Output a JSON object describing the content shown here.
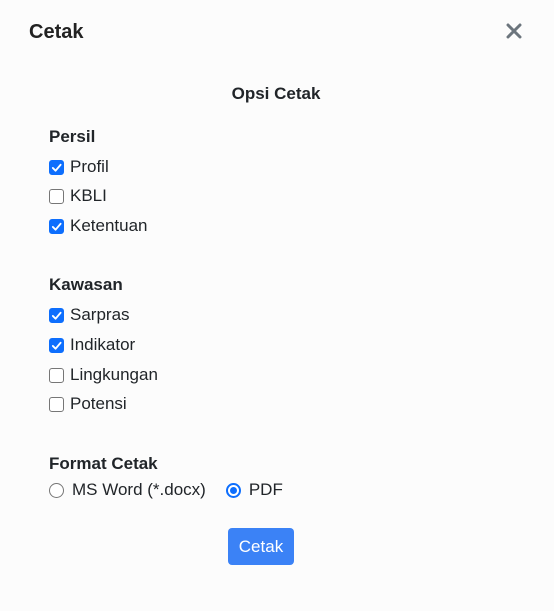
{
  "dialog": {
    "title": "Cetak",
    "close_icon": "close-icon",
    "heading": "Opsi Cetak"
  },
  "persil": {
    "title": "Persil",
    "options": [
      {
        "label": "Profil",
        "checked": true
      },
      {
        "label": "KBLI",
        "checked": false
      },
      {
        "label": "Ketentuan",
        "checked": true
      }
    ]
  },
  "kawasan": {
    "title": "Kawasan",
    "options": [
      {
        "label": "Sarpras",
        "checked": true
      },
      {
        "label": "Indikator",
        "checked": true
      },
      {
        "label": "Lingkungan",
        "checked": false
      },
      {
        "label": "Potensi",
        "checked": false
      }
    ]
  },
  "format": {
    "title": "Format Cetak",
    "options": [
      {
        "label": "MS Word (*.docx)",
        "selected": false
      },
      {
        "label": "PDF",
        "selected": true
      }
    ]
  },
  "submit_label": "Cetak",
  "colors": {
    "accent": "#0d6efd",
    "button": "#3b82f6"
  }
}
